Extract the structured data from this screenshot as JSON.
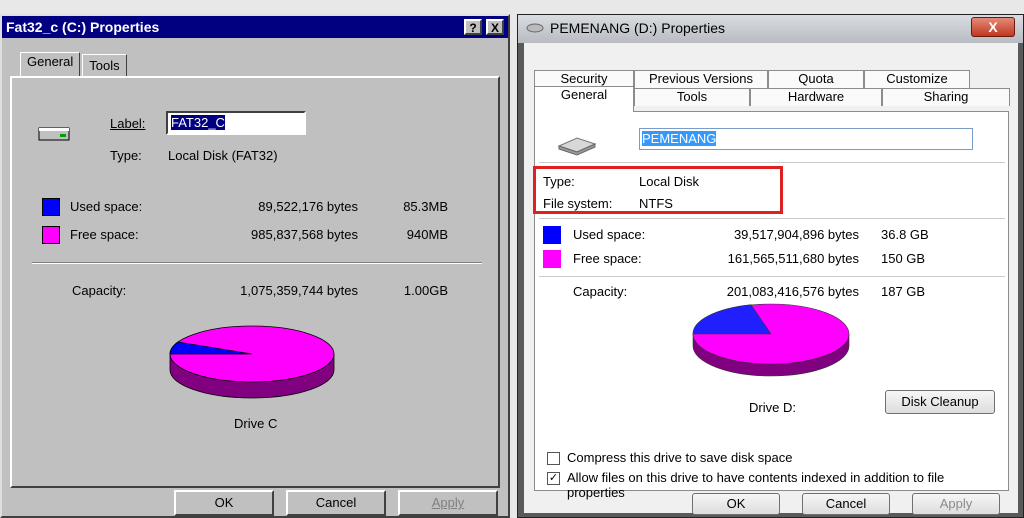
{
  "left": {
    "title": "Fat32_c (C:) Properties",
    "help_btn": "?",
    "close_btn": "X",
    "tabs": [
      "General",
      "Tools"
    ],
    "label_caption": "Label:",
    "label_value": "FAT32_C",
    "type_caption": "Type:",
    "type_value": "Local Disk (FAT32)",
    "used": {
      "label": "Used space:",
      "bytes": "89,522,176 bytes",
      "size": "85.3MB",
      "color": "#0000ff"
    },
    "free": {
      "label": "Free space:",
      "bytes": "985,837,568 bytes",
      "size": "940MB",
      "color": "#ff00ff"
    },
    "capacity": {
      "label": "Capacity:",
      "bytes": "1,075,359,744 bytes",
      "size": "1.00GB"
    },
    "drive_label": "Drive C",
    "buttons": {
      "ok": "OK",
      "cancel": "Cancel",
      "apply": "Apply"
    }
  },
  "right": {
    "title": "PEMENANG (D:) Properties",
    "close_btn": "X",
    "tabs_back": [
      "Security",
      "Previous Versions",
      "Quota",
      "Customize"
    ],
    "tabs_front": [
      "General",
      "Tools",
      "Hardware",
      "Sharing"
    ],
    "name_value": "PEMENANG",
    "type_caption": "Type:",
    "type_value": "Local Disk",
    "fs_caption": "File system:",
    "fs_value": "NTFS",
    "used": {
      "label": "Used space:",
      "bytes": "39,517,904,896 bytes",
      "size": "36.8 GB",
      "color": "#0000ff"
    },
    "free": {
      "label": "Free space:",
      "bytes": "161,565,511,680 bytes",
      "size": "150 GB",
      "color": "#ff00ff"
    },
    "capacity": {
      "label": "Capacity:",
      "bytes": "201,083,416,576 bytes",
      "size": "187 GB"
    },
    "drive_label": "Drive D:",
    "cleanup_btn": "Disk Cleanup",
    "compress_label": "Compress this drive to save disk space",
    "index_label": "Allow files on this drive to have contents indexed in addition to file properties",
    "index_checked": true,
    "buttons": {
      "ok": "OK",
      "cancel": "Cancel",
      "apply": "Apply"
    }
  }
}
